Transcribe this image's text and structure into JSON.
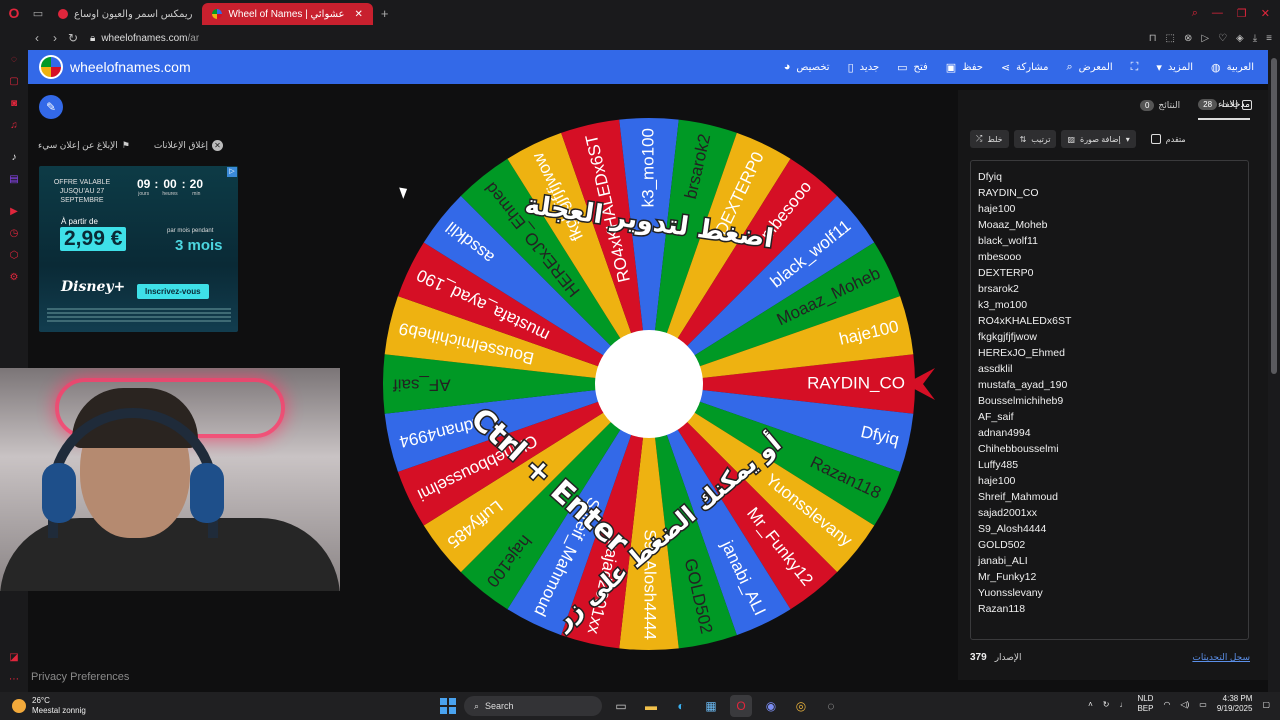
{
  "browser": {
    "tabs": [
      {
        "label": "ريمكس اسمر والعيون اوساع",
        "fav_color": "#e0263c",
        "active": false
      },
      {
        "label": "Wheel of Names | عشوائي",
        "fav_color": "#ffffff",
        "active": true
      }
    ],
    "url_host": "wheelofnames.com",
    "url_path": "/ar"
  },
  "site": {
    "name": "wheelofnames.com",
    "menu": [
      {
        "label": "تخصيص",
        "icon": "palette-icon"
      },
      {
        "label": "جديد",
        "icon": "new-file-icon"
      },
      {
        "label": "فتح",
        "icon": "folder-icon"
      },
      {
        "label": "حفظ",
        "icon": "save-icon"
      },
      {
        "label": "مشاركة",
        "icon": "share-icon"
      },
      {
        "label": "المعرض",
        "icon": "gallery-icon"
      },
      {
        "label": "",
        "icon": "fullscreen-icon"
      },
      {
        "label": "المزيد",
        "icon": "chevron-down-icon"
      },
      {
        "label": "العربية",
        "icon": "globe-icon"
      }
    ]
  },
  "ad_area": {
    "close_ads": "إغلاق الإعلانات",
    "report_ad": "الإبلاغ عن إعلان سيء",
    "banner": {
      "offer": "OFFRE VALABLE JUSQU'AU 27 SEPTEMBRE",
      "timer": [
        {
          "num": "09",
          "lbl": "jours"
        },
        {
          "num": "00",
          "lbl": "heures"
        },
        {
          "num": "20",
          "lbl": "min"
        }
      ],
      "apartir": "À partir de",
      "price": "2,99 €",
      "permois": "par mois pendant",
      "mois": "3 mois",
      "brand": "Disney+",
      "cta": "Inscrivez-vous"
    }
  },
  "wheel": {
    "center_text_top": "اضغط لتدوير العجلة",
    "center_text_bottom": "أو يمكنك الضغط على زر",
    "shortcut": "Ctrl + Enter",
    "colors": [
      "#3369e8",
      "#d50f25",
      "#eeb211",
      "#009925"
    ],
    "pointer_color": "#d50f25",
    "order_from_right_clockwise": [
      "RAYDIN_CO",
      "Dfyiq",
      "Razan118",
      "Yuonsslevany",
      "Mr_Funky12",
      "janabi_ALI",
      "GOLD502",
      "S9_Alosh4444",
      "sajad2001xx",
      "Shreif_Mahmoud",
      "haje100",
      "Luffy485",
      "Chihebbousselmi",
      "adnan4994",
      "AF_saif",
      "Bousselmichiheb9",
      "mustafa_ayad_190",
      "assdklil",
      "HERExJO_Ehmed",
      "fkgkgjfjfjwow",
      "RO4xKHALEDx6ST",
      "k3_mo100",
      "brsarok2",
      "DEXTERP0",
      "mbesooo",
      "black_wolf11",
      "Moaaz_Moheb",
      "haje100"
    ]
  },
  "panel": {
    "tab_entries": "مدخلات",
    "entries_count": "28",
    "tab_results": "النتائج",
    "results_count": "0",
    "hide": "إخفاء",
    "shuffle": "خلط",
    "sort": "ترتيب",
    "add_image": "إضافة صورة",
    "advanced": "متقدم",
    "entries": [
      "Dfyiq",
      "RAYDIN_CO",
      "haje100",
      "Moaaz_Moheb",
      "black_wolf11",
      "mbesooo",
      "DEXTERP0",
      "brsarok2",
      "k3_mo100",
      "RO4xKHALEDx6ST",
      "fkgkgjfjfjwow",
      "HERExJO_Ehmed",
      "assdklil",
      "mustafa_ayad_190",
      "Bousselmichiheb9",
      "AF_saif",
      "adnan4994",
      "Chihebbousselmi",
      "Luffy485",
      "haje100",
      "Shreif_Mahmoud",
      "sajad2001xx",
      "S9_Alosh4444",
      "GOLD502",
      "janabi_ALI",
      "Mr_Funky12",
      "Yuonsslevany",
      "Razan118"
    ],
    "version_label": "الإصدار",
    "version": "379",
    "changelog": "سجل التحديثات"
  },
  "privacy": "Privacy Preferences",
  "taskbar": {
    "temp": "26°C",
    "weather": "Meestal zonnig",
    "search": "Search",
    "lang1": "NLD",
    "lang2": "BEP",
    "time": "4:38 PM",
    "date": "9/19/2025"
  }
}
